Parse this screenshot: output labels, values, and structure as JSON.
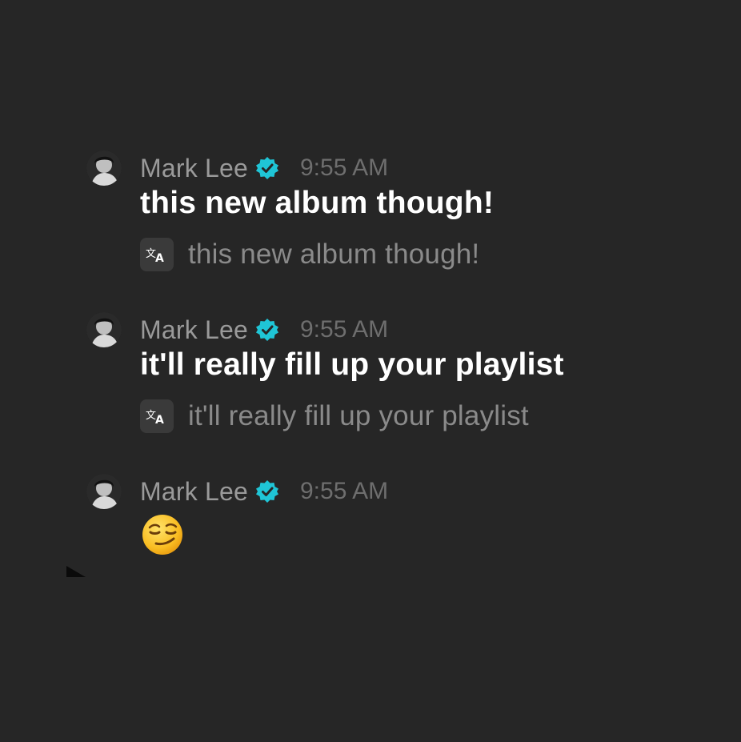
{
  "messages": [
    {
      "author": "Mark Lee",
      "verified": true,
      "time": "9:55 AM",
      "text": "this new album though!",
      "translation": "this new album though!"
    },
    {
      "author": "Mark Lee",
      "verified": true,
      "time": "9:55 AM",
      "text": "it'll really fill up your playlist",
      "translation": "it'll really fill up your playlist"
    },
    {
      "author": "Mark Lee",
      "verified": true,
      "time": "9:55 AM",
      "emoji": "smirking-face-emoji"
    }
  ],
  "icons": {
    "verified": "verified-badge-icon",
    "translate": "translate-icon"
  },
  "colors": {
    "background": "#262626",
    "verified_badge": "#1fc5d6",
    "author_text": "#9a9a9a",
    "time_text": "#6e6e6e",
    "message_text": "#ffffff",
    "translation_text": "#8a8a8a"
  }
}
